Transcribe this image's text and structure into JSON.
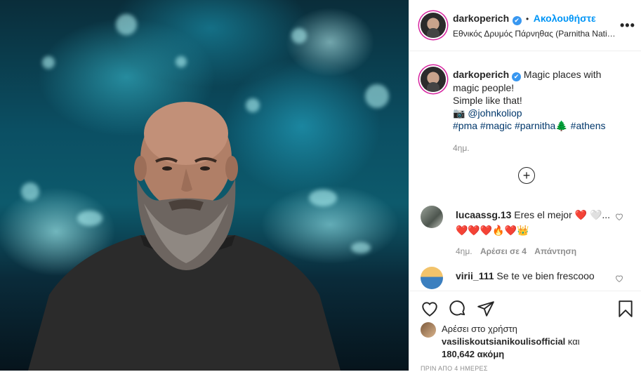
{
  "post": {
    "username": "darkoperich",
    "verified_mark": "✔",
    "dot": "•",
    "follow_label": "Ακολουθήστε",
    "location": "Εθνικός Δρυμός Πάρνηθας (Parnitha National Park)",
    "more_label": "•••"
  },
  "caption": {
    "username": "darkoperich",
    "line1": "Magic places with magic people!",
    "line2": "Simple like that!",
    "camera_emoji": "📷",
    "mention": "@johnkoliop",
    "tags": [
      "#pma",
      "#magic",
      "#parnitha",
      "#athens"
    ],
    "tree_emoji": "🌲",
    "time": "4ημ."
  },
  "load_more_label": "+",
  "comments": [
    {
      "username": "lucaassg.13",
      "text": "Eres el mejor",
      "emoji_line1": "❤️ 🤍...",
      "emoji_line2": "❤️❤️❤️🔥❤️👑",
      "time": "4ημ.",
      "likes": "Αρέσει σε 4",
      "reply": "Απάντηση"
    },
    {
      "username": "virii_111",
      "text": "Se te ve bien frescooo"
    }
  ],
  "likes": {
    "prefix": "Αρέσει στο χρήστη",
    "user": "vasiliskoutsianikoulisofficial",
    "and": "και",
    "others": "180,642 ακόμη"
  },
  "posted_ago": "ΠΡΙΝ ΑΠΟ 4 ΗΜΕΡΕΣ",
  "icons": [
    "heart-icon",
    "comment-icon",
    "share-icon",
    "bookmark-icon",
    "plus-circle-icon",
    "more-icon",
    "verified-icon"
  ],
  "colors": {
    "accent": "#0095f6",
    "verified": "#3897f0",
    "hashtag": "#00376b",
    "secondary": "#8e8e8e",
    "heart_red": "#ed4956"
  }
}
